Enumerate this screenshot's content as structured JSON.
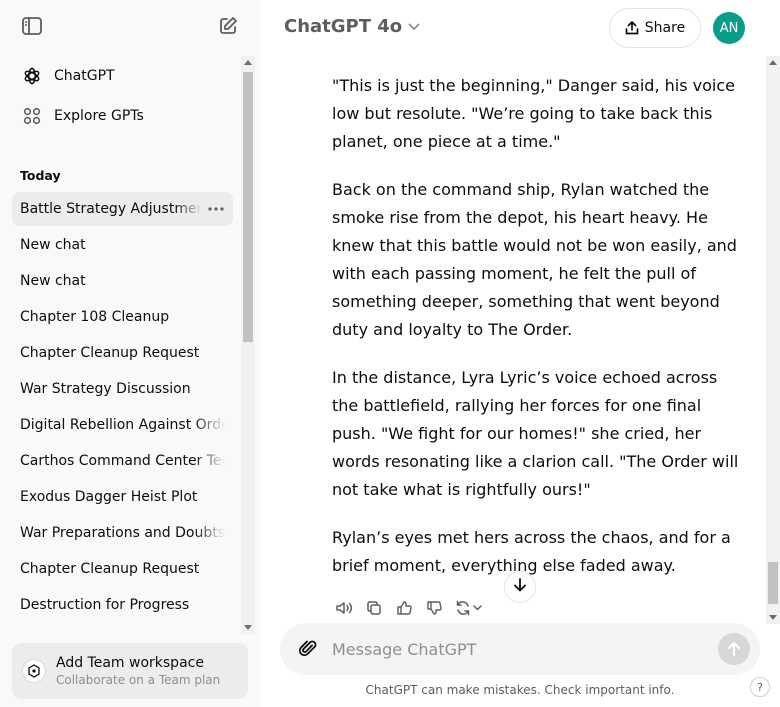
{
  "sidebar": {
    "toggle_icon": "sidebar-toggle-icon",
    "new_chat_icon": "compose-icon",
    "nav": [
      {
        "label": "ChatGPT",
        "icon": "openai-logo-icon"
      },
      {
        "label": "Explore GPTs",
        "icon": "grid-icon"
      }
    ],
    "section_today": "Today",
    "history": [
      "Battle Strategy Adjustments",
      "New chat",
      "New chat",
      "Chapter 108 Cleanup",
      "Chapter Cleanup Request",
      "War Strategy Discussion",
      "Digital Rebellion Against Order",
      "Carthos Command Center Tech",
      "Exodus Dagger Heist Plot",
      "War Preparations and Doubts",
      "Chapter Cleanup Request",
      "Destruction for Progress"
    ],
    "team": {
      "title": "Add Team workspace",
      "subtitle": "Collaborate on a Team plan"
    }
  },
  "header": {
    "model": "ChatGPT 4o",
    "share": "Share",
    "avatar_initials": "AN",
    "avatar_color": "#0a9d8c"
  },
  "message": {
    "paragraphs": [
      "\"This is just the beginning,\" Danger said, his voice low but resolute. \"We’re going to take back this planet, one piece at a time.\"",
      "Back on the command ship, Rylan watched the smoke rise from the depot, his heart heavy. He knew that this battle would not be won easily, and with each passing moment, he felt the pull of something deeper, something that went beyond duty and loyalty to The Order.",
      "In the distance, Lyra Lyric’s voice echoed across the battlefield, rallying her forces for one final push. \"We fight for our homes!\" she cried, her words resonating like a clarion call. \"The Order will not take what is rightfully ours!\"",
      "Rylan’s eyes met hers across the chaos, and for a brief moment, everything else faded away."
    ]
  },
  "composer": {
    "placeholder": "Message ChatGPT"
  },
  "footer": {
    "disclaimer": "ChatGPT can make mistakes. Check important info.",
    "help": "?"
  }
}
